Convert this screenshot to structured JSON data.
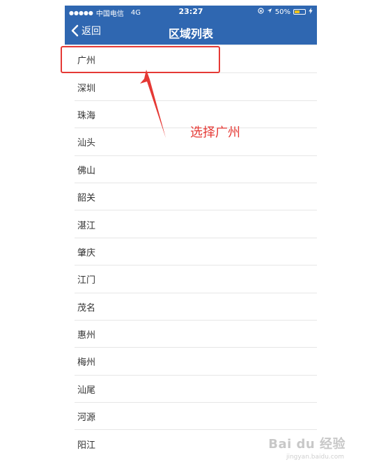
{
  "status_bar": {
    "signal": "●●●●●",
    "carrier": "中国电信",
    "network": "4G",
    "time": "23:27",
    "battery_percent": "50%",
    "battery_level": 0.5,
    "battery_color": "#f3c318"
  },
  "nav": {
    "back_label": "返回",
    "title": "区域列表",
    "bar_color": "#2f67b1"
  },
  "list": {
    "items": [
      "广州",
      "深圳",
      "珠海",
      "汕头",
      "佛山",
      "韶关",
      "湛江",
      "肇庆",
      "江门",
      "茂名",
      "惠州",
      "梅州",
      "汕尾",
      "河源",
      "阳江"
    ]
  },
  "annotation": {
    "text": "选择广州",
    "color": "#e53935"
  },
  "watermark": {
    "text": "Bai du 经验",
    "sub": "jingyan.baidu.com"
  }
}
